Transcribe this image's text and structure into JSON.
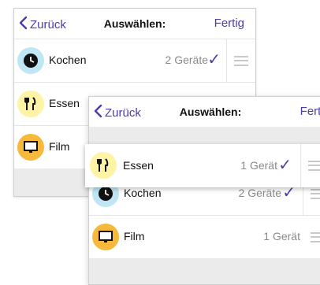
{
  "nav": {
    "back_label": "Zurück",
    "title": "Auswählen:",
    "done_label": "Fertig"
  },
  "back_card": {
    "rows": [
      {
        "label": "Kochen",
        "count": "2 Geräte",
        "icon": "clock-icon",
        "checked": true
      },
      {
        "label": "Essen",
        "icon": "fork-knife-icon"
      },
      {
        "label": "Film",
        "icon": "tv-icon"
      }
    ]
  },
  "front_card": {
    "dragged": {
      "label": "Essen",
      "count": "1 Gerät",
      "icon": "fork-knife-icon",
      "checked": true
    },
    "rows": [
      {
        "label": "Kochen",
        "count": "2 Geräte",
        "icon": "clock-icon",
        "checked": true
      },
      {
        "label": "Film",
        "count": "1 Gerät",
        "icon": "tv-icon",
        "checked": false
      }
    ]
  },
  "colors": {
    "accent": "#4a3ea8",
    "clock_bg": "#bfe6f5",
    "essen_bg": "#fff3a6",
    "film_bg": "#f6b93b"
  }
}
